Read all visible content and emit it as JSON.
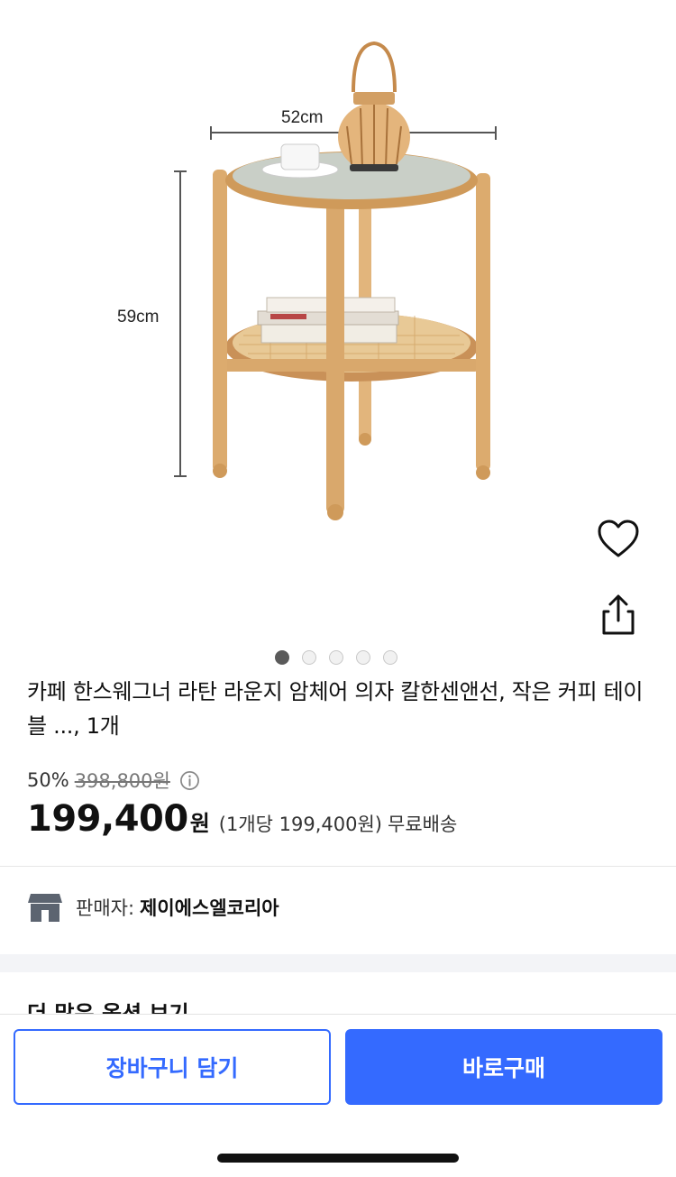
{
  "product": {
    "image": {
      "width_label": "52cm",
      "height_label": "59cm",
      "description": "wooden round side table"
    },
    "image_pager": {
      "total": 5,
      "active": 1
    },
    "title": "카페 한스웨그너 라탄 라운지 암체어 의자 칼한센앤선, 작은 커피 테이블 ..., 1개",
    "discount_rate": "50%",
    "original_price": "398,800원",
    "sale_price": "199,400",
    "price_unit": "원",
    "unit_price": "(1개당 199,400원)",
    "shipping": "무료배송"
  },
  "seller": {
    "label": "판매자:",
    "name": "제이에스엘코리아"
  },
  "more_options_label": "더 많은 옵션 보기",
  "actions": {
    "cart_label": "장바구니 담기",
    "buy_label": "바로구매"
  },
  "icons": {
    "wish": "heart-icon",
    "share": "share-icon",
    "info": "info-icon",
    "seller": "store-icon"
  },
  "colors": {
    "accent": "#346aff",
    "wood": "#d9a86c",
    "glass": "#c9cfc7"
  }
}
